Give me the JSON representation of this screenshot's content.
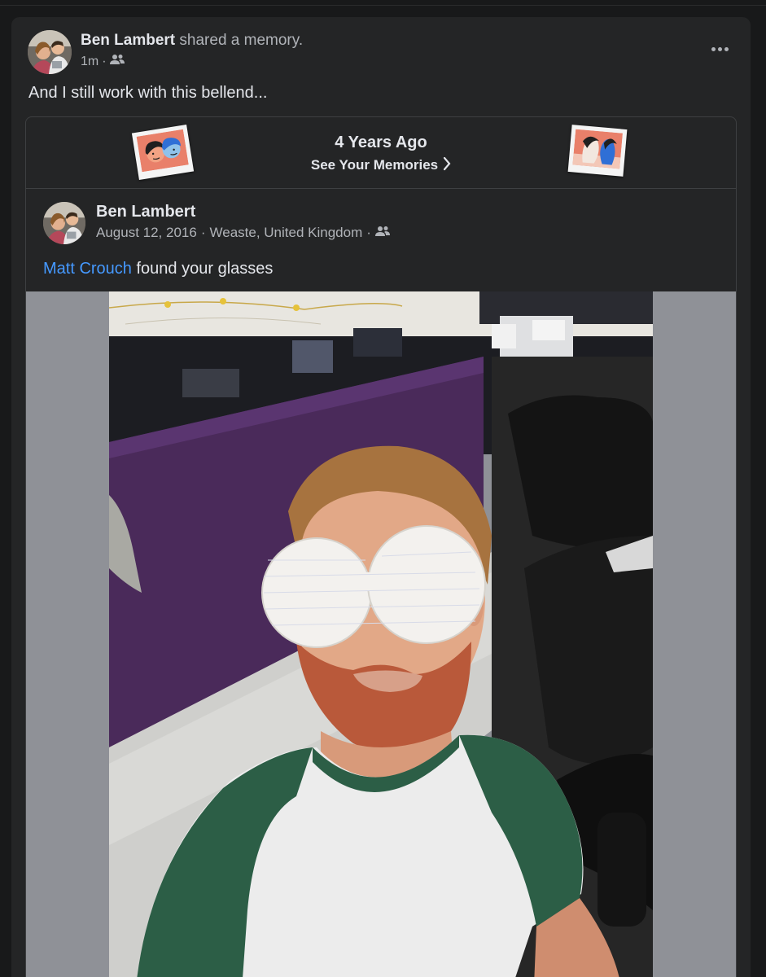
{
  "post": {
    "author": "Ben Lambert",
    "action": "shared a memory.",
    "time": "1m",
    "audience_icon": "friends-icon",
    "text": "And I still work with this bellend...",
    "more_icon": "more-options-icon"
  },
  "memory": {
    "title": "4 Years Ago",
    "link_label": "See Your Memories",
    "original": {
      "author": "Ben Lambert",
      "date": "August 12, 2016",
      "location": "Weaste, United Kingdom",
      "tagged": "Matt Crouch",
      "text_rest": "found your glasses"
    }
  },
  "colors": {
    "card_bg": "#242526",
    "page_bg": "#18191a",
    "text_primary": "#e4e6eb",
    "text_secondary": "#b0b3b8",
    "link": "#4599ff",
    "photo_letterbox": "#8f9197"
  }
}
